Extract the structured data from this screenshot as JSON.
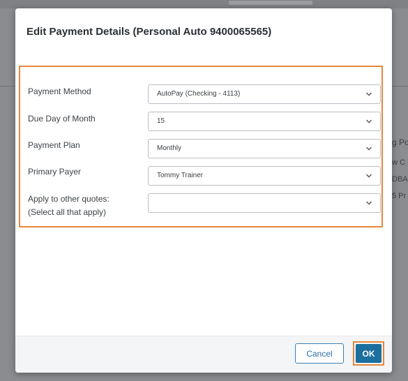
{
  "background": {
    "top_fragment": "",
    "right_fragments": [
      "g Po",
      "w C",
      "DBA",
      "5 Pr"
    ]
  },
  "modal": {
    "title": "Edit Payment Details (Personal Auto 9400065565)",
    "fields": [
      {
        "label": "Payment Method",
        "value": "AutoPay (Checking - 4113)"
      },
      {
        "label": "Due Day of Month",
        "value": "15"
      },
      {
        "label": "Payment Plan",
        "value": "Monthly"
      },
      {
        "label": "Primary Payer",
        "value": "Tommy Trainer"
      },
      {
        "label_line1": "Apply to other quotes:",
        "label_line2": "(Select all that apply)",
        "value": ""
      }
    ],
    "buttons": {
      "cancel": "Cancel",
      "ok": "OK"
    }
  },
  "colors": {
    "highlight": "#e8873a",
    "primary_button": "#1c6f9f",
    "secondary_button_border": "#3b7fb4"
  },
  "icons": {
    "dropdown": "chevron-down-icon"
  }
}
